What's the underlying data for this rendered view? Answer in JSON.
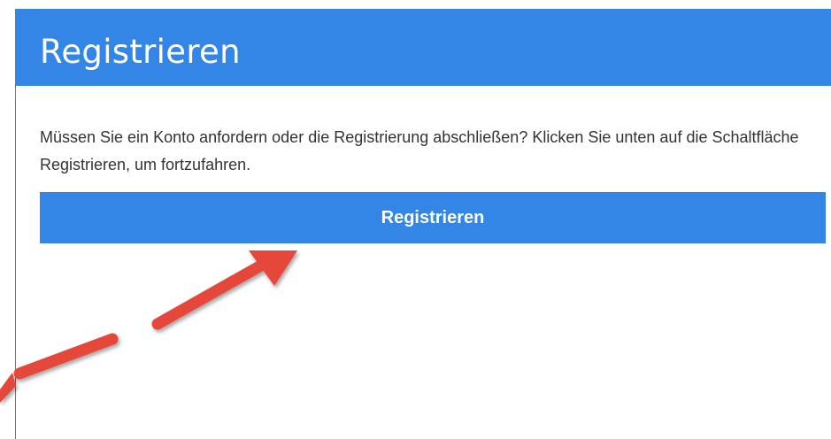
{
  "panel": {
    "title": "Registrieren",
    "description": "Müssen Sie ein Konto anfordern oder die Registrierung abschließen? Klicken Sie unten auf die Schaltfläche Registrieren, um fortzufahren.",
    "button_label": "Registrieren"
  },
  "colors": {
    "header_bg": "#3386e6",
    "button_bg": "#3386e6",
    "arrow": "#e5463b",
    "text": "#333333"
  },
  "annotation": {
    "type": "dashed-arrow",
    "points_to": "register-button",
    "icon": "red-arrow"
  }
}
